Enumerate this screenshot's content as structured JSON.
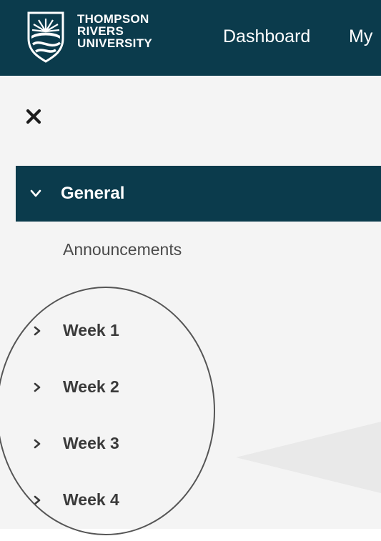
{
  "header": {
    "logo_lines": [
      "THOMPSON",
      "RIVERS",
      "UNIVERSITY"
    ],
    "nav": [
      "Dashboard",
      "My"
    ]
  },
  "drawer": {
    "close_icon": "close-icon",
    "sections": {
      "general": {
        "label": "General",
        "expanded": true,
        "items": [
          "Announcements"
        ]
      },
      "weeks": [
        {
          "label": "Week 1",
          "expanded": false
        },
        {
          "label": "Week 2",
          "expanded": false
        },
        {
          "label": "Week 3",
          "expanded": false
        },
        {
          "label": "Week 4",
          "expanded": false
        }
      ]
    }
  },
  "colors": {
    "brand": "#0b3b4c",
    "drawer_bg": "#f4f4f4",
    "text_dark": "#3a3a3a",
    "annotation": "#555555"
  }
}
